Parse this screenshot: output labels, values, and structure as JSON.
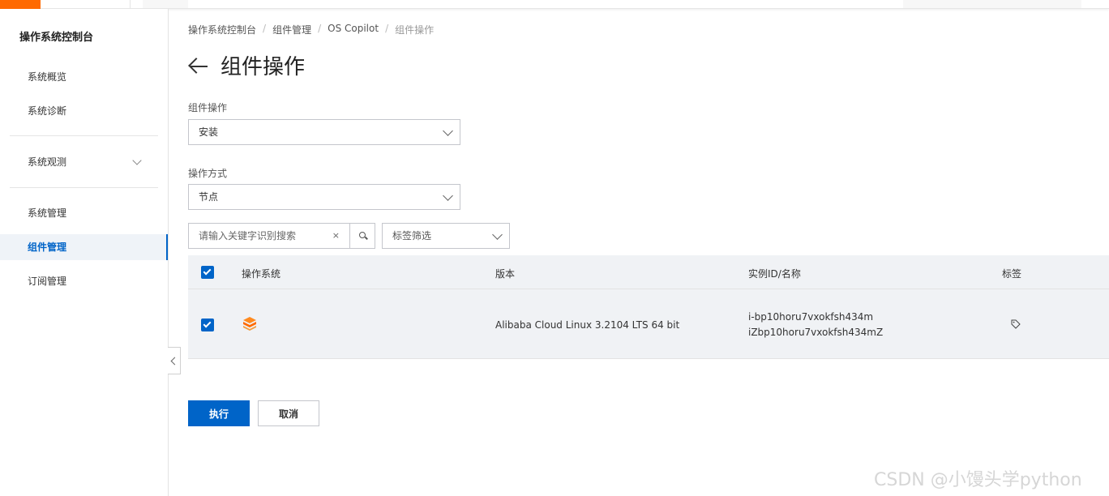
{
  "sidebar": {
    "title": "操作系统控制台",
    "items": [
      {
        "label": "系统概览"
      },
      {
        "label": "系统诊断"
      },
      {
        "label": "系统观测"
      },
      {
        "label": "系统管理"
      },
      {
        "label": "组件管理"
      },
      {
        "label": "订阅管理"
      }
    ]
  },
  "breadcrumb": [
    "操作系统控制台",
    "组件管理",
    "OS Copilot",
    "组件操作"
  ],
  "page": {
    "title": "组件操作"
  },
  "form": {
    "operation_label": "组件操作",
    "operation_value": "安装",
    "method_label": "操作方式",
    "method_value": "节点"
  },
  "filters": {
    "search_placeholder": "请输入关键字识别搜索",
    "clear_glyph": "×",
    "tag_filter": "标签筛选"
  },
  "table": {
    "headers": [
      "操作系统",
      "版本",
      "实例ID/名称",
      "标签"
    ],
    "rows": [
      {
        "checked": true,
        "version": "Alibaba Cloud Linux  3.2104 LTS 64 bit",
        "instance_id": "i-bp10horu7vxokfsh434m",
        "instance_name": "iZbp10horu7vxokfsh434mZ"
      }
    ]
  },
  "actions": {
    "execute": "执行",
    "cancel": "取消"
  },
  "watermark": "CSDN @小馒头学python",
  "colors": {
    "brand": "#ff6a00",
    "primary": "#0064c8"
  }
}
